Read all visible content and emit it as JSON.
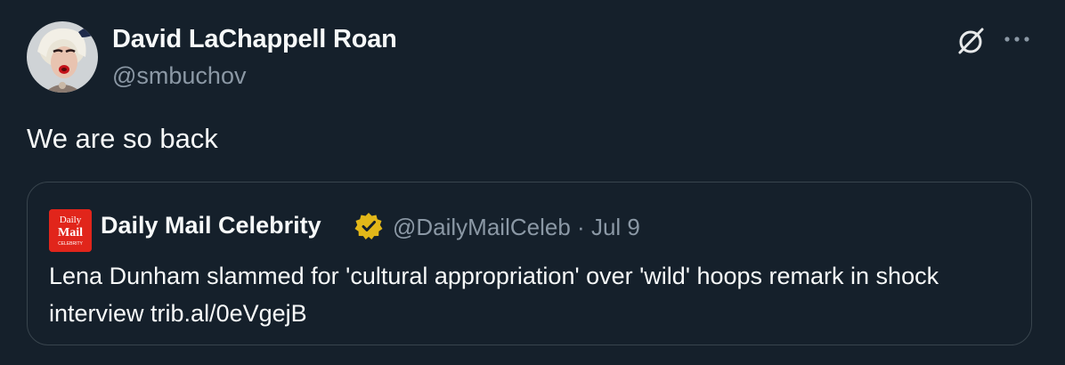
{
  "author": {
    "display_name": "David LaChappell Roan",
    "handle": "@smbuchov"
  },
  "tweet": {
    "text": "We are so back"
  },
  "actions": {
    "grok_icon": "grok-icon",
    "more_icon": "more-icon"
  },
  "quoted_tweet": {
    "display_name": "Daily Mail Celebrity",
    "verified": true,
    "handle": "@DailyMailCeleb",
    "separator": "·",
    "date": "Jul 9",
    "text": "Lena Dunham slammed for 'cultural appropriation' over 'wild' hoops remark in shock interview trib.al/0eVgejB",
    "avatar_logo": {
      "line1": "Daily",
      "line2": "Mail",
      "line3": "CELEBRITY"
    }
  },
  "colors": {
    "background": "#15202b",
    "text_primary": "#f7f9f9",
    "text_secondary": "#8b98a5",
    "border": "#38444d",
    "verified_gold": "#e2b719",
    "daily_mail_red": "#e1251b"
  }
}
